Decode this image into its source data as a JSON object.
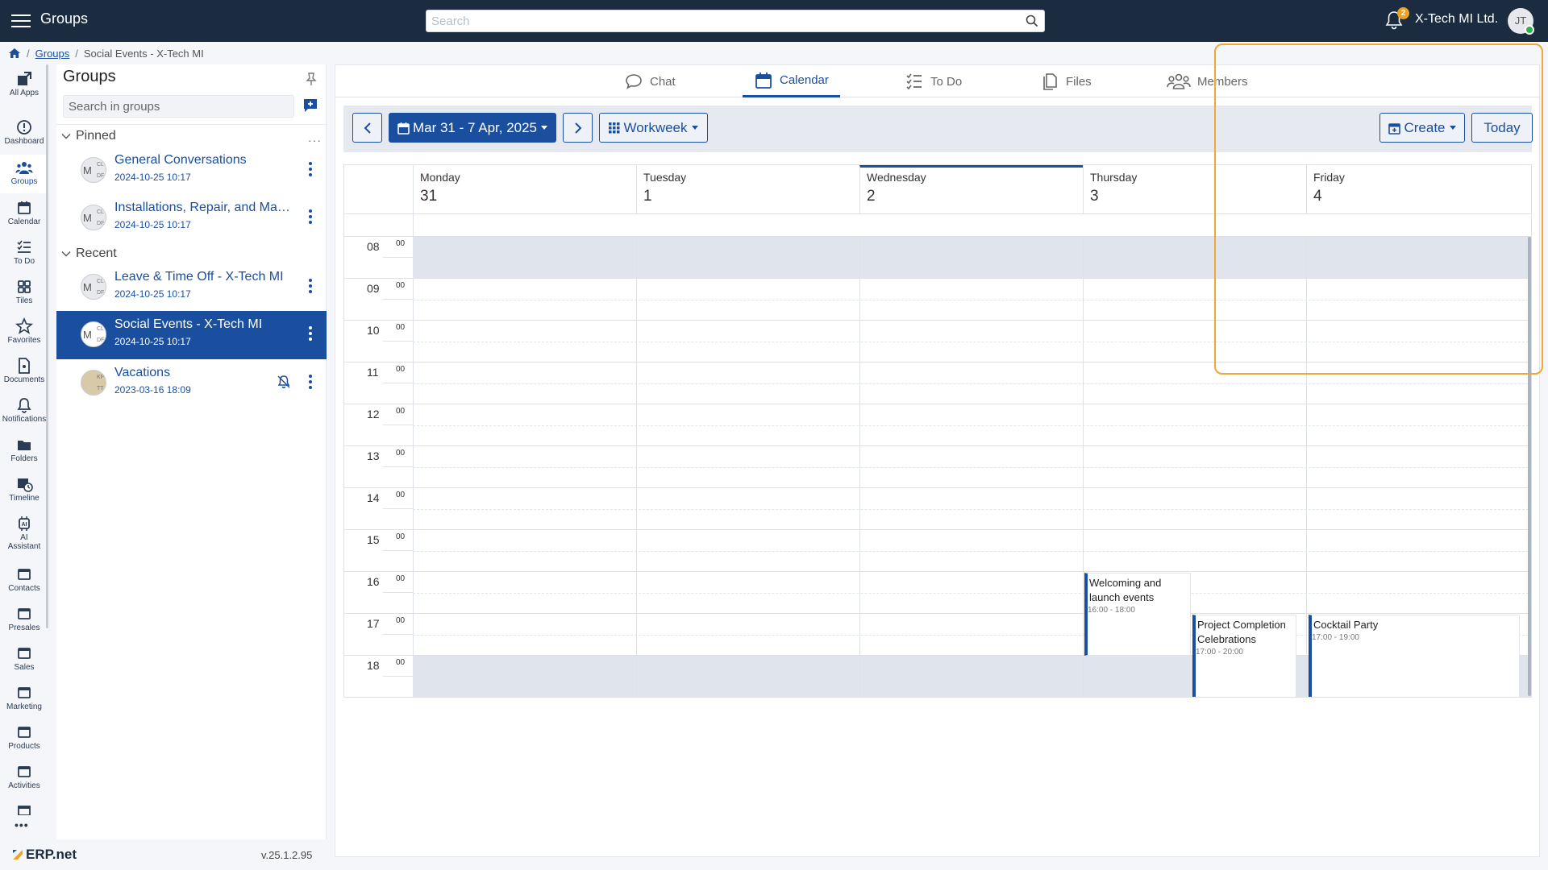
{
  "header": {
    "app_title": "Groups",
    "search_placeholder": "Search",
    "notification_count": "2",
    "company": "X-Tech MI Ltd.",
    "user_initials": "JT"
  },
  "breadcrumb": {
    "link": "Groups",
    "current": "Social Events - X-Tech MI"
  },
  "appnav": {
    "items": [
      {
        "label": "All Apps",
        "icon": "all-apps-icon"
      },
      {
        "label": "Dashboard",
        "icon": "dashboard-icon"
      },
      {
        "label": "Groups",
        "icon": "groups-icon",
        "active": true
      },
      {
        "label": "Calendar",
        "icon": "calendar-icon"
      },
      {
        "label": "To Do",
        "icon": "todo-icon"
      },
      {
        "label": "Tiles",
        "icon": "tiles-icon"
      },
      {
        "label": "Favorites",
        "icon": "star-icon"
      },
      {
        "label": "Documents",
        "icon": "document-icon"
      },
      {
        "label": "Notifications",
        "icon": "bell-icon"
      },
      {
        "label": "Folders",
        "icon": "folder-icon"
      },
      {
        "label": "Timeline",
        "icon": "timeline-icon"
      },
      {
        "label": "AI Assistant",
        "icon": "ai-icon"
      },
      {
        "label": "Contacts",
        "icon": "window-icon"
      },
      {
        "label": "Presales",
        "icon": "window-icon"
      },
      {
        "label": "Sales",
        "icon": "window-icon"
      },
      {
        "label": "Marketing",
        "icon": "window-icon"
      },
      {
        "label": "Products",
        "icon": "window-icon"
      },
      {
        "label": "Activities",
        "icon": "window-icon"
      }
    ],
    "more": "•••"
  },
  "groups_panel": {
    "title": "Groups",
    "search_placeholder": "Search in groups",
    "pinned_label": "Pinned",
    "recent_label": "Recent",
    "pinned": [
      {
        "name": "General Conversations",
        "date": "2024-10-25 10:17",
        "avatar": "M",
        "a1": "CL",
        "a2": "DF"
      },
      {
        "name": "Installations, Repair, and Maintenance",
        "date": "2024-10-25 10:17",
        "avatar": "M",
        "a1": "CL",
        "a2": "DF"
      }
    ],
    "recent": [
      {
        "name": "Leave & Time Off - X-Tech MI",
        "date": "2024-10-25 10:17",
        "avatar": "M",
        "a1": "CL",
        "a2": "DF"
      },
      {
        "name": "Social Events - X-Tech MI",
        "date": "2024-10-25 10:17",
        "avatar": "M",
        "a1": "CL",
        "a2": "DF",
        "active": true
      },
      {
        "name": "Vacations",
        "date": "2023-03-16 18:09",
        "avatar": "",
        "a1": "KP",
        "a2": "TT",
        "muted": true
      }
    ],
    "version": "v.25.1.2.95",
    "logo_text": "ERP.net"
  },
  "tabs": [
    {
      "label": "Chat",
      "icon": "chat-icon"
    },
    {
      "label": "Calendar",
      "icon": "calendar-icon",
      "active": true
    },
    {
      "label": "To Do",
      "icon": "todo-icon"
    },
    {
      "label": "Files",
      "icon": "files-icon"
    },
    {
      "label": "Members",
      "icon": "members-icon"
    }
  ],
  "toolbar": {
    "date_range": "Mar 31 - 7 Apr, 2025",
    "view": "Workweek",
    "create": "Create",
    "today": "Today"
  },
  "calendar": {
    "days": [
      {
        "name": "Monday",
        "date": "31"
      },
      {
        "name": "Tuesday",
        "date": "1"
      },
      {
        "name": "Wednesday",
        "date": "2",
        "today": true
      },
      {
        "name": "Thursday",
        "date": "3"
      },
      {
        "name": "Friday",
        "date": "4"
      }
    ],
    "hours": [
      "08",
      "09",
      "10",
      "11",
      "12",
      "13",
      "14",
      "15",
      "16",
      "17",
      "18"
    ],
    "minute_label": "00",
    "events": [
      {
        "title": "Welcoming and launch events",
        "time": "16:00 - 18:00",
        "day": 3
      },
      {
        "title": "Project Completion Celebrations",
        "time": "17:00 - 20:00",
        "day": 3
      },
      {
        "title": "Cocktail Party",
        "time": "17:00 - 19:00",
        "day": 4
      }
    ]
  },
  "colors": {
    "topbar": "#1b2b40",
    "accent": "#1a4fa0",
    "highlight_outline": "#f0a73a",
    "offhours": "#dfe4ed"
  }
}
